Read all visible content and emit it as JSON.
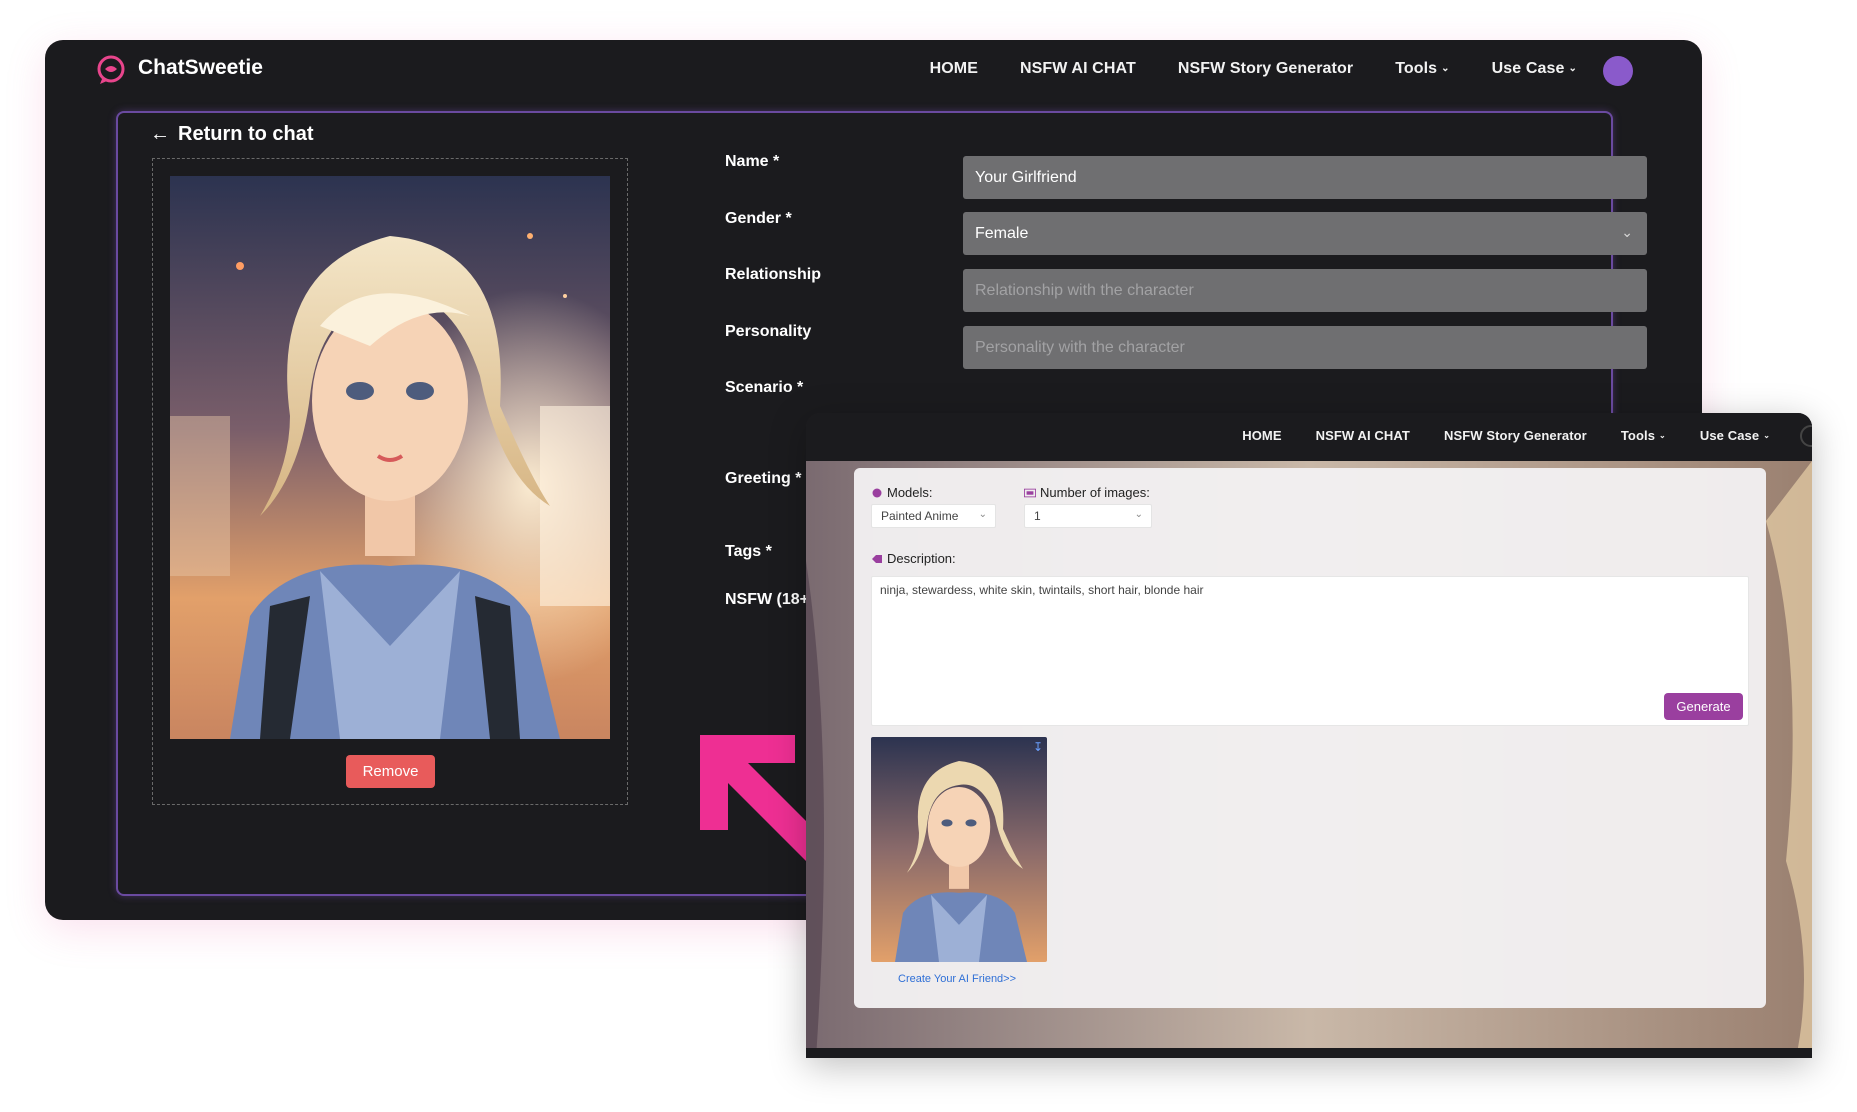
{
  "brand": {
    "name": "ChatSweetie",
    "accent": "#e8458c",
    "avatar_color": "#8a5acb"
  },
  "nav": {
    "home": "HOME",
    "chat": "NSFW AI CHAT",
    "story": "NSFW Story Generator",
    "tools": "Tools",
    "usecase": "Use Case"
  },
  "editor": {
    "return_label": "Return to chat",
    "remove_label": "Remove",
    "fields": {
      "name": {
        "label": "Name *",
        "value": "Your Girlfriend"
      },
      "gender": {
        "label": "Gender *",
        "value": "Female"
      },
      "relationship": {
        "label": "Relationship",
        "placeholder": "Relationship with the character"
      },
      "personality": {
        "label": "Personality",
        "placeholder": "Personality with the character"
      },
      "scenario": {
        "label": "Scenario *"
      },
      "greeting": {
        "label": "Greeting *"
      },
      "tags": {
        "label": "Tags *"
      },
      "nsfw": {
        "label": "NSFW (18+)"
      }
    }
  },
  "generator": {
    "models_label": "Models:",
    "models_value": "Painted Anime",
    "count_label": "Number of images:",
    "count_value": "1",
    "description_label": "Description:",
    "description_value": "ninja, stewardess, white skin, twintails, short hair, blonde hair",
    "generate_label": "Generate",
    "generate_color": "#9a3f9f",
    "create_link": "Create Your AI Friend>>"
  },
  "annotation": {
    "arrow_color": "#ee2f93"
  }
}
